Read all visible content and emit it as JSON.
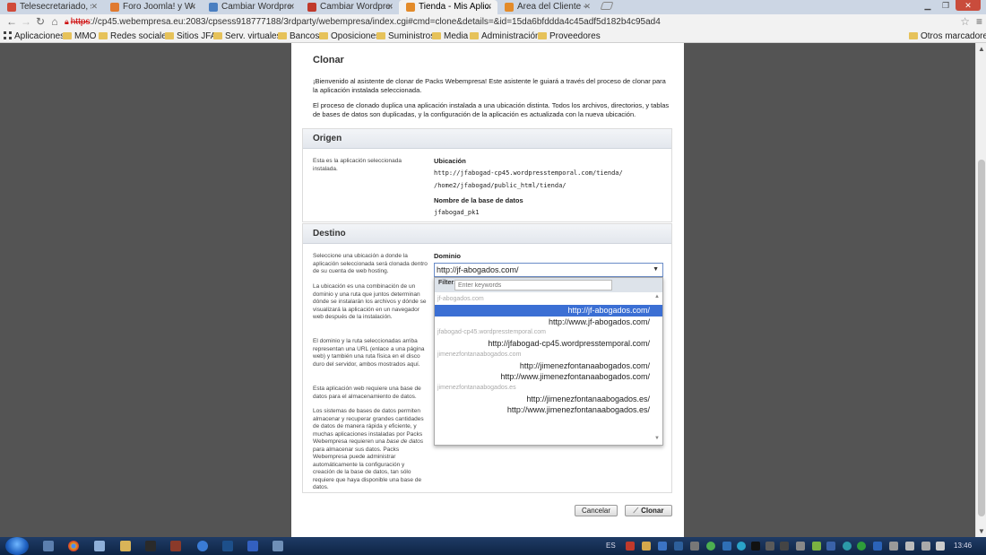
{
  "browser": {
    "tabs": [
      {
        "label": "Telesecretariado, se",
        "color": "#d04a3a",
        "active": false
      },
      {
        "label": "Foro Joomla! y Word",
        "color": "#e07a30",
        "active": false
      },
      {
        "label": "Cambiar Wordpress",
        "color": "#4a7fc1",
        "active": false
      },
      {
        "label": "Cambiar Wordpress",
        "color": "#c0392b",
        "active": false
      },
      {
        "label": "Tienda - Mis Aplicac",
        "color": "#e38b2a",
        "active": true
      },
      {
        "label": "Área del Cliente - w",
        "color": "#e38b2a",
        "active": false
      }
    ],
    "url_scheme": "https",
    "url_rest": "://cp45.webempresa.eu:2083/cpsess918777188/3rdparty/webempresa/index.cgi#cmd=clone&details=&id=15da6bfddda4c45adf5d182b4c95ad4",
    "bookmarks": [
      {
        "label": "Aplicaciones",
        "icon": "apps-icon"
      },
      {
        "label": "MMO",
        "icon": "folder-icon"
      },
      {
        "label": "Redes sociales",
        "icon": "folder-icon"
      },
      {
        "label": "Sitios JFA",
        "icon": "folder-icon"
      },
      {
        "label": "Serv. virtuales",
        "icon": "folder-icon"
      },
      {
        "label": "Bancos",
        "icon": "folder-icon"
      },
      {
        "label": "Oposiciones",
        "icon": "folder-icon"
      },
      {
        "label": "Suministros",
        "icon": "folder-icon"
      },
      {
        "label": "Media",
        "icon": "folder-icon"
      },
      {
        "label": "Administración",
        "icon": "folder-icon"
      },
      {
        "label": "Proveedores",
        "icon": "folder-icon"
      }
    ],
    "other_bookmarks": "Otros marcadores"
  },
  "page": {
    "title": "Clonar",
    "intro_1": "¡Bienvenido al asistente de clonar de Packs Webempresa! Este asistente le guiará a través del proceso de clonar para la aplicación instalada seleccionada.",
    "intro_2": "El proceso de clonado duplica una aplicación instalada a una ubicación distinta. Todos los archivos, directorios, y tablas de bases de datos son duplicadas, y la configuración de la aplicación es actualizada con la nueva ubicación.",
    "origen": {
      "heading": "Origen",
      "side": "Esta es la aplicación seleccionada instalada.",
      "ubicacion_label": "Ubicación",
      "ubicacion_url": "http://jfabogad-cp45.wordpresstemporal.com/tienda/",
      "ubicacion_path": "/home2/jfabogad/public_html/tienda/",
      "db_label": "Nombre de la base de datos",
      "db_value": "jfabogad_pk1"
    },
    "destino": {
      "heading": "Destino",
      "side_1": "Seleccione una ubicación a donde la aplicación seleccionada será clonada dentro de su cuenta de web hosting.",
      "side_2": "La ubicación es una combinación de un dominio y una ruta que juntos determinan dónde se instalarán los archivos y dónde se visualizará la aplicación en un navegador web después de la instalación.",
      "side_3": "El dominio y la ruta seleccionadas arriba representan una URL (enlace a una página web) y también una ruta física en el disco duro del servidor, ambos mostrados aquí.",
      "side_4": "Esta aplicación web requiere una base de datos para el almacenamiento de datos.",
      "side_5_a": "Los sistemas de bases de datos permiten almacenar y recuperar grandes cantidades de datos de manera rápida y eficiente, y muchas aplicaciones instaladas por Packs Webempresa requieren una ",
      "side_5_em": "base de datos",
      "side_5_b": " para almacenar sus datos. Packs Webempresa puede administrar automáticamente la configuración y creación de la base de datos, tan sólo requiere que haya disponible una base de datos.",
      "dominio_label": "Dominio",
      "dominio_selected": "http://jf-abogados.com/",
      "filter_label": "Filter:",
      "filter_placeholder": "Enter keywords",
      "groups": [
        {
          "name": "jf-abogados.com",
          "options": [
            {
              "label": "http://jf-abogados.com/",
              "selected": true
            },
            {
              "label": "http://www.jf-abogados.com/",
              "selected": false
            }
          ]
        },
        {
          "name": "jfabogad-cp45.wordpresstemporal.com",
          "options": [
            {
              "label": "http://jfabogad-cp45.wordpresstemporal.com/",
              "selected": false
            }
          ]
        },
        {
          "name": "jimenezfontanaabogados.com",
          "options": [
            {
              "label": "http://jimenezfontanaabogados.com/",
              "selected": false
            },
            {
              "label": "http://www.jimenezfontanaabogados.com/",
              "selected": false
            }
          ]
        },
        {
          "name": "jimenezfontanaabogados.es",
          "options": [
            {
              "label": "http://jimenezfontanaabogados.es/",
              "selected": false
            },
            {
              "label": "http://www.jimenezfontanaabogados.es/",
              "selected": false
            }
          ]
        }
      ]
    },
    "cancel_label": "Cancelar",
    "clone_label": "Clonar"
  },
  "taskbar": {
    "language": "ES",
    "clock": "13:46"
  }
}
